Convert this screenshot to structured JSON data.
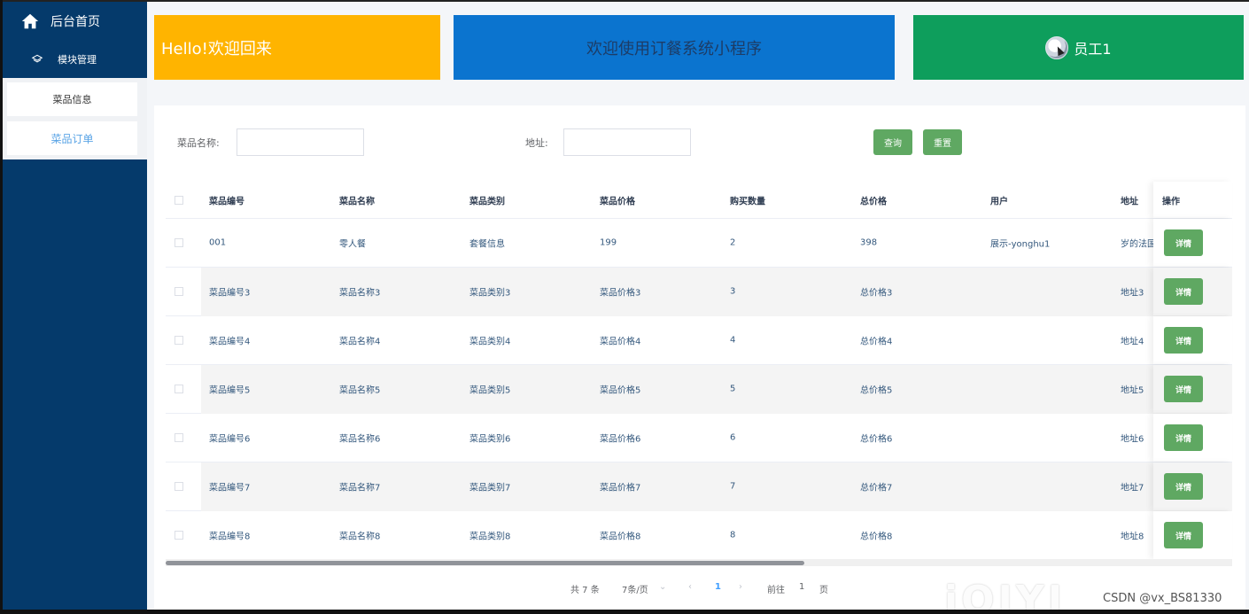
{
  "sidebar": {
    "home_label": "后台首页",
    "module_label": "模块管理",
    "sub_items": [
      {
        "label": "菜品信息"
      },
      {
        "label": "菜品订单"
      }
    ]
  },
  "header": {
    "greeting": "Hello!欢迎回来",
    "system_title": "欢迎使用订餐系统小程序",
    "user_name": "员工1"
  },
  "search": {
    "dish_name_label": "菜品名称:",
    "dish_name_value": "",
    "address_label": "地址:",
    "address_value": "",
    "query_button": "查询",
    "reset_button": "重置"
  },
  "table": {
    "columns": [
      "菜品编号",
      "菜品名称",
      "菜品类别",
      "菜品价格",
      "购买数量",
      "总价格",
      "用户",
      "地址",
      "操作"
    ],
    "detail_label": "详情",
    "rows": [
      {
        "code": "001",
        "name": "零人餐",
        "category": "套餐信息",
        "price": "199",
        "qty": "2",
        "total": "398",
        "user": "展示-yonghu1",
        "address": "岁的法国"
      },
      {
        "code": "菜品编号3",
        "name": "菜品名称3",
        "category": "菜品类别3",
        "price": "菜品价格3",
        "qty": "3",
        "total": "总价格3",
        "user": "",
        "address": "地址3"
      },
      {
        "code": "菜品编号4",
        "name": "菜品名称4",
        "category": "菜品类别4",
        "price": "菜品价格4",
        "qty": "4",
        "total": "总价格4",
        "user": "",
        "address": "地址4"
      },
      {
        "code": "菜品编号5",
        "name": "菜品名称5",
        "category": "菜品类别5",
        "price": "菜品价格5",
        "qty": "5",
        "total": "总价格5",
        "user": "",
        "address": "地址5"
      },
      {
        "code": "菜品编号6",
        "name": "菜品名称6",
        "category": "菜品类别6",
        "price": "菜品价格6",
        "qty": "6",
        "total": "总价格6",
        "user": "",
        "address": "地址6"
      },
      {
        "code": "菜品编号7",
        "name": "菜品名称7",
        "category": "菜品类别7",
        "price": "菜品价格7",
        "qty": "7",
        "total": "总价格7",
        "user": "",
        "address": "地址7"
      },
      {
        "code": "菜品编号8",
        "name": "菜品名称8",
        "category": "菜品类别8",
        "price": "菜品价格8",
        "qty": "8",
        "total": "总价格8",
        "user": "",
        "address": "地址8"
      }
    ]
  },
  "pagination": {
    "total": "共 7 条",
    "page_size": "7条/页",
    "prev": "‹",
    "current_page": "1",
    "next": "›",
    "goto_label": "前往",
    "goto_value": "1",
    "page_unit": "页"
  },
  "watermark": {
    "logo": "iQIYI",
    "text": "CSDN @vx_BS81330"
  },
  "colors": {
    "sidebar_bg": "#053a6b",
    "card_yellow": "#ffb400",
    "card_blue": "#0b74cf",
    "card_green": "#0e9e5c",
    "button_green": "#5fa862",
    "active_link": "#409eff"
  },
  "icons": {
    "home": "home-icon",
    "module": "layers-icon",
    "avatar": "avatar-icon"
  }
}
